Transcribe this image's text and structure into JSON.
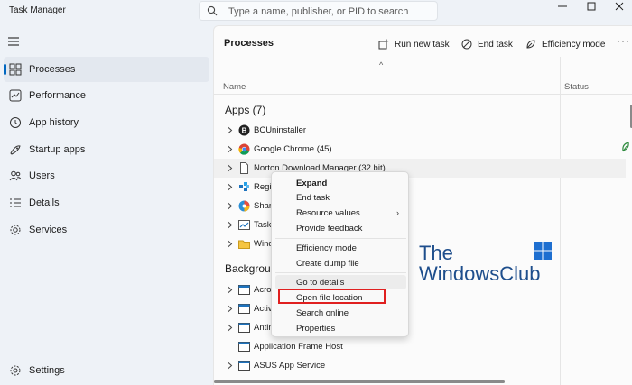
{
  "window": {
    "title": "Task Manager",
    "minimize_icon": "minimize-icon",
    "maximize_icon": "maximize-icon",
    "close_icon": "close-icon"
  },
  "search": {
    "placeholder": "Type a name, publisher, or PID to search",
    "value": ""
  },
  "sidebar": {
    "items": [
      {
        "label": "Processes",
        "icon": "processes-icon",
        "active": true
      },
      {
        "label": "Performance",
        "icon": "performance-icon"
      },
      {
        "label": "App history",
        "icon": "app-history-icon"
      },
      {
        "label": "Startup apps",
        "icon": "startup-apps-icon"
      },
      {
        "label": "Users",
        "icon": "users-icon"
      },
      {
        "label": "Details",
        "icon": "details-icon"
      },
      {
        "label": "Services",
        "icon": "services-icon"
      }
    ],
    "settings_label": "Settings"
  },
  "main": {
    "title": "Processes",
    "toolbar": {
      "run_new_task": "Run new task",
      "end_task": "End task",
      "efficiency_mode": "Efficiency mode",
      "more": "···"
    },
    "columns": {
      "name": "Name",
      "status": "Status"
    },
    "apps_section": "Apps (7)",
    "apps": [
      {
        "name": "BCUninstaller",
        "icon": "bcuninstaller-icon"
      },
      {
        "name": "Google Chrome (45)",
        "icon": "chrome-icon"
      },
      {
        "name": "Norton Download Manager (32 bit)",
        "icon": "file-icon"
      },
      {
        "name": "Regis",
        "icon": "registry-icon"
      },
      {
        "name": "Share",
        "icon": "sharex-icon"
      },
      {
        "name": "Task M",
        "icon": "task-manager-icon"
      },
      {
        "name": "Wind",
        "icon": "folder-icon"
      }
    ],
    "background_section": "Backgrou",
    "background": [
      {
        "name": "Acrol",
        "icon": "window-icon"
      },
      {
        "name": "Activ",
        "icon": "window-icon"
      },
      {
        "name": "Antim",
        "icon": "window-icon"
      },
      {
        "name": "Application Frame Host",
        "icon": "window-icon"
      },
      {
        "name": "ASUS App Service",
        "icon": "window-icon"
      }
    ]
  },
  "context_menu": {
    "items": [
      {
        "label": "Expand",
        "bold": true
      },
      {
        "label": "End task"
      },
      {
        "label": "Resource values",
        "submenu": true
      },
      {
        "label": "Provide feedback"
      },
      {
        "label": "Efficiency mode"
      },
      {
        "label": "Create dump file"
      },
      {
        "label": "Go to details",
        "hover": true
      },
      {
        "label": "Open file location",
        "highlighted": true
      },
      {
        "label": "Search online"
      },
      {
        "label": "Properties"
      }
    ]
  },
  "watermark": {
    "line1": "The",
    "line2": "WindowsClub"
  },
  "colors": {
    "accent": "#0067c0",
    "highlight_box": "#e02020",
    "watermark": "#1e4e8c"
  }
}
